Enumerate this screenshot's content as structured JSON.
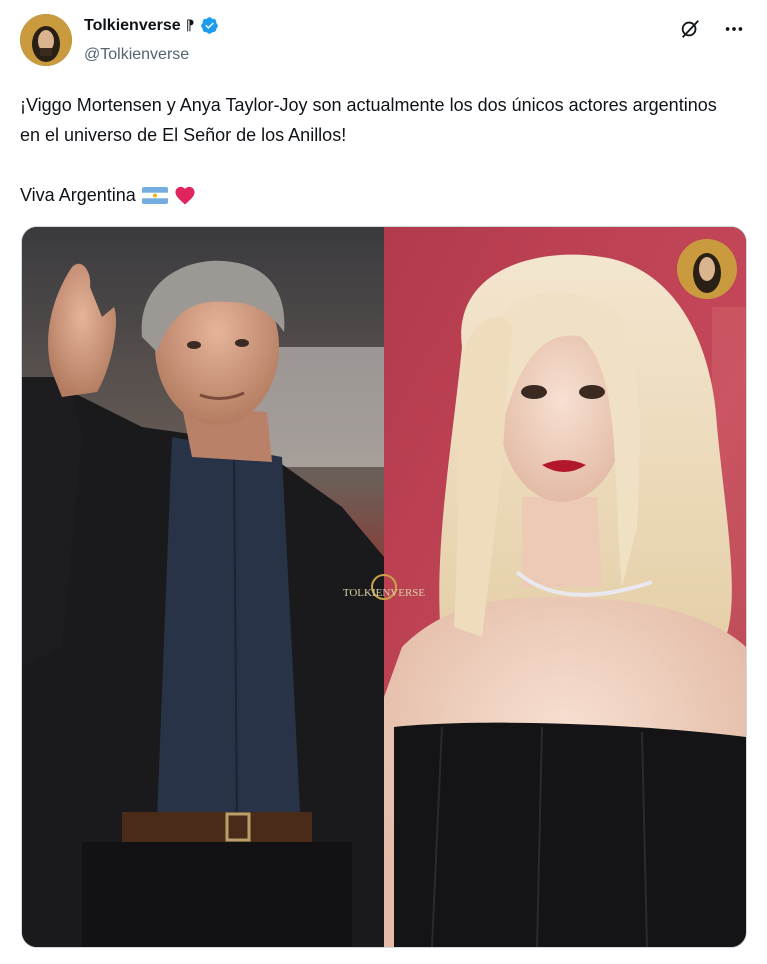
{
  "account": {
    "display_name": "Tolkienverse",
    "name_glyph": "⁋",
    "handle": "@Tolkienverse"
  },
  "tweet": {
    "text": "¡Viggo Mortensen y Anya Taylor-Joy son actualmente los dos únicos actores argentinos en el universo de El Señor de los Anillos!",
    "line2": "Viva Argentina"
  },
  "media": {
    "watermark": "TOLKIENVERSE"
  },
  "colors": {
    "verified": "#1d9bf0",
    "text": "#0f1419",
    "secondary": "#536471",
    "heart": "#e0245e",
    "flag_blue": "#74acdf"
  },
  "icons": [
    "verified-icon",
    "grok-icon",
    "more-icon",
    "argentina-flag-icon",
    "heart-icon"
  ]
}
